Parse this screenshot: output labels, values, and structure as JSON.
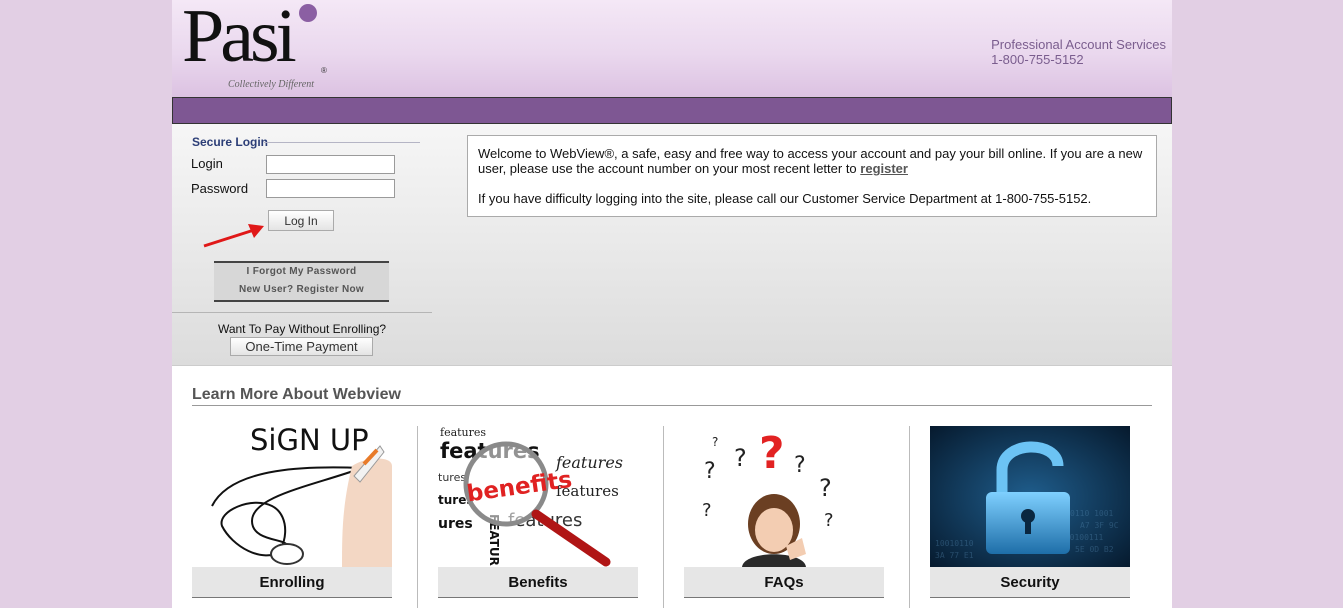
{
  "header": {
    "logo_text": "Pasi",
    "logo_reg": "®",
    "logo_tagline": "Collectively Different",
    "contact_name": "Professional Account Services",
    "contact_phone": "1-800-755-5152"
  },
  "login": {
    "title": "Secure Login",
    "login_label": "Login",
    "login_value": "",
    "password_label": "Password",
    "password_value": "",
    "submit_label": "Log In",
    "forgot_password": "I Forgot My Password",
    "register_now": "New User? Register Now",
    "pay_question": "Want To Pay Without Enrolling?",
    "one_time_label": "One-Time Payment"
  },
  "welcome": {
    "para1_before": "Welcome to WebView®, a safe, easy and free way to access your account and pay your bill online. If you are a new user, please use the account number on your most recent letter to ",
    "register_link": "register",
    "para2": "If you have difficulty logging into the site, please call our Customer Service Department at 1-800-755-5152."
  },
  "learn": {
    "title": "Learn More About Webview",
    "cards": [
      {
        "label": "Enrolling",
        "img_text": "SiGN UP"
      },
      {
        "label": "Benefits",
        "img_text": "benefits",
        "words": [
          "features",
          "features",
          "features",
          "features",
          "tures",
          "tures",
          "ures",
          "FEATURES",
          "features"
        ]
      },
      {
        "label": "FAQs"
      },
      {
        "label": "Security"
      }
    ]
  },
  "colors": {
    "brand_purple": "#7e5793",
    "background": "#e2cfe4",
    "header_text": "#7a5d8e"
  }
}
